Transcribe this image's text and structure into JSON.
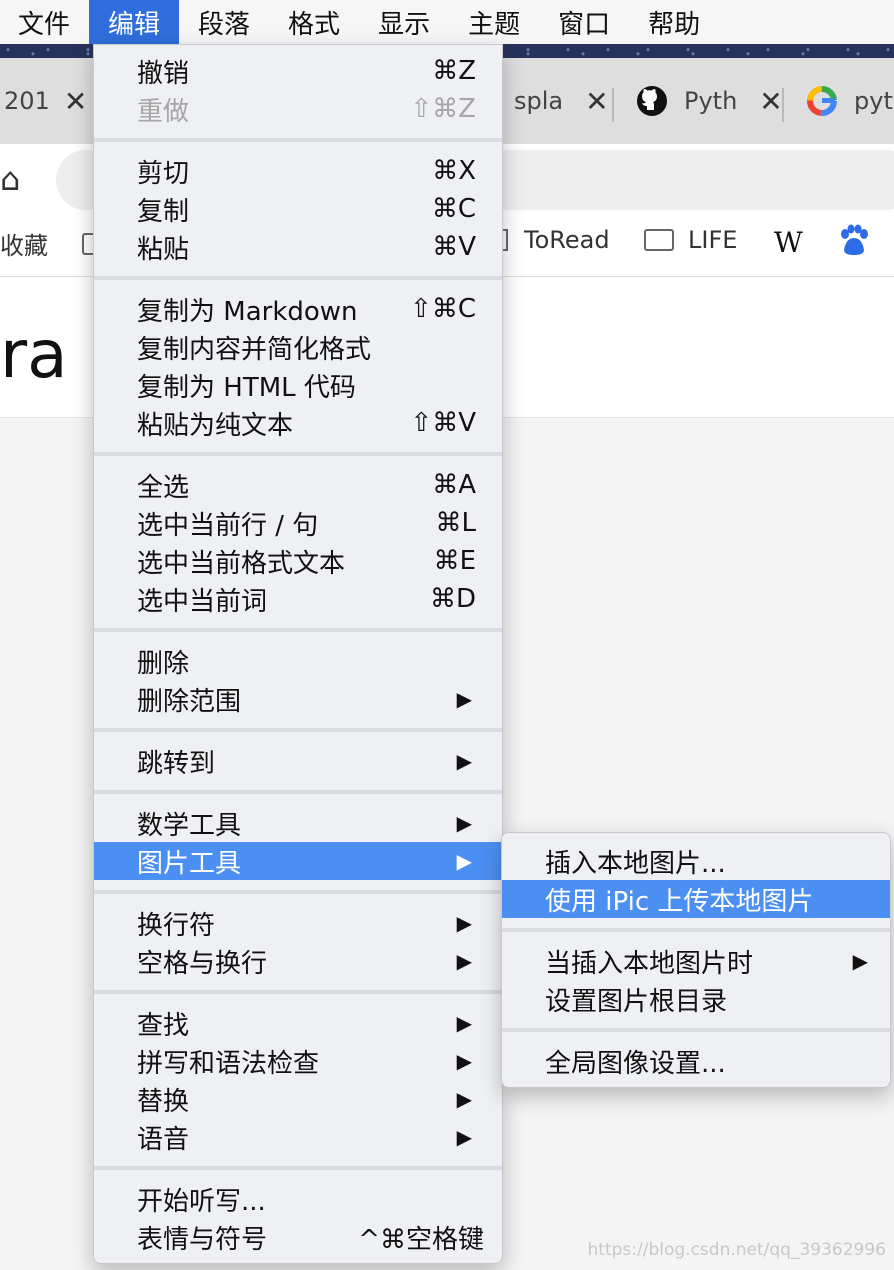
{
  "menubar": [
    "文件",
    "编辑",
    "段落",
    "格式",
    "显示",
    "主题",
    "窗口",
    "帮助"
  ],
  "tabs": [
    {
      "label": "201",
      "close": "✕"
    },
    {
      "label": "spla",
      "close": "✕"
    },
    {
      "label": "Pyth",
      "close": "✕"
    },
    {
      "label": "pyth"
    }
  ],
  "bookmarks": {
    "fav": "收藏",
    "toread": "ToRead",
    "life": "LIFE",
    "wiki": "W"
  },
  "page": {
    "brand_tail": "ra"
  },
  "edit_menu": {
    "undo": {
      "label": "撤销",
      "shortcut": "⌘Z"
    },
    "redo": {
      "label": "重做",
      "shortcut": "⇧⌘Z"
    },
    "cut": {
      "label": "剪切",
      "shortcut": "⌘X"
    },
    "copy": {
      "label": "复制",
      "shortcut": "⌘C"
    },
    "paste": {
      "label": "粘贴",
      "shortcut": "⌘V"
    },
    "copy_md": {
      "label": "复制为 Markdown",
      "shortcut": "⇧⌘C"
    },
    "copy_simplify": {
      "label": "复制内容并简化格式"
    },
    "copy_html": {
      "label": "复制为 HTML 代码"
    },
    "paste_plain": {
      "label": "粘贴为纯文本",
      "shortcut": "⇧⌘V"
    },
    "select_all": {
      "label": "全选",
      "shortcut": "⌘A"
    },
    "select_line": {
      "label": "选中当前行 / 句",
      "shortcut": "⌘L"
    },
    "select_format": {
      "label": "选中当前格式文本",
      "shortcut": "⌘E"
    },
    "select_word": {
      "label": "选中当前词",
      "shortcut": "⌘D"
    },
    "delete": {
      "label": "删除"
    },
    "delete_range": {
      "label": "删除范围"
    },
    "jump_to": {
      "label": "跳转到"
    },
    "math_tools": {
      "label": "数学工具"
    },
    "image_tools": {
      "label": "图片工具"
    },
    "line_break": {
      "label": "换行符"
    },
    "spaces": {
      "label": "空格与换行"
    },
    "find": {
      "label": "查找"
    },
    "spelling": {
      "label": "拼写和语法检查"
    },
    "substitutions": {
      "label": "替换"
    },
    "speech": {
      "label": "语音"
    },
    "dictation": {
      "label": "开始听写..."
    },
    "emoji": {
      "label": "表情与符号",
      "shortcut": "^⌘空格键"
    },
    "arrow": "▶"
  },
  "image_submenu": {
    "insert_local": "插入本地图片...",
    "upload_ipic": "使用 iPic 上传本地图片",
    "when_insert": "当插入本地图片时",
    "set_root": "设置图片根目录",
    "global_settings": "全局图像设置..."
  },
  "watermark": "https://blog.csdn.net/qq_39362996"
}
